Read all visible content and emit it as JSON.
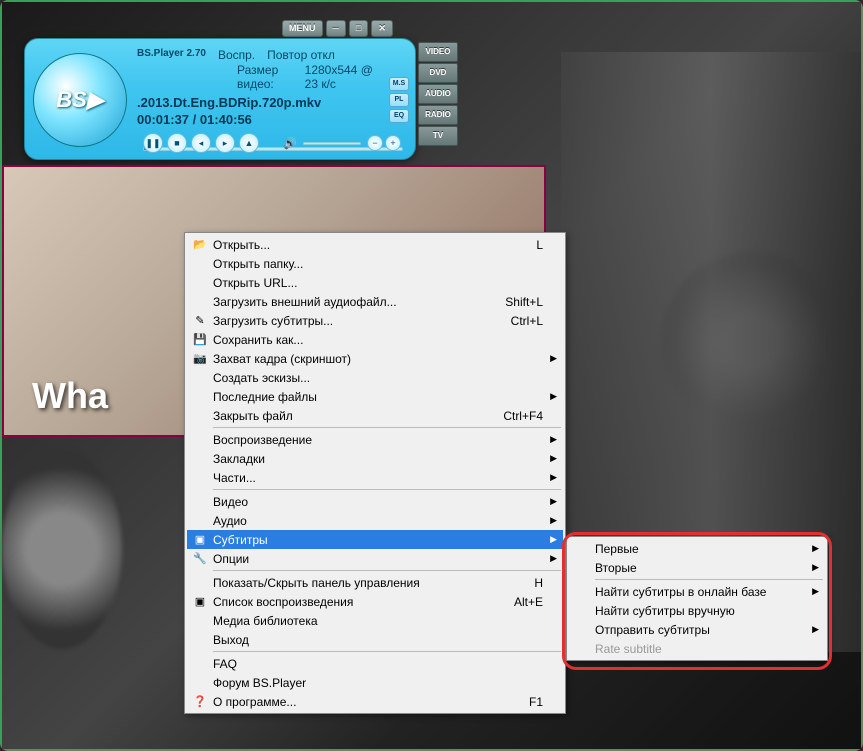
{
  "topbar": {
    "menu": "MENU"
  },
  "player": {
    "logo": "BS▶",
    "title": "BS.Player 2.70",
    "playback": "Воспр.",
    "repeat": "Повтор откл",
    "videosize_label": "Размер видео:",
    "videosize": "1280x544 @ 23 к/с",
    "file": ".2013.Dt.Eng.BDRip.720p.mkv",
    "time": "00:01:37 / 01:40:56",
    "lang_btns": [
      "M.S",
      "PL",
      "EQ"
    ]
  },
  "sidebar": [
    "VIDEO",
    "DVD",
    "AUDIO",
    "RADIO",
    "TV"
  ],
  "video": {
    "text": "Wha"
  },
  "menu": [
    {
      "icon": "📂",
      "label": "Открыть...",
      "hotkey": "L"
    },
    {
      "label": "Открыть папку..."
    },
    {
      "label": "Открыть URL..."
    },
    {
      "label": "Загрузить внешний аудиофайл...",
      "hotkey": "Shift+L"
    },
    {
      "icon": "✎",
      "label": "Загрузить субтитры...",
      "hotkey": "Ctrl+L"
    },
    {
      "icon": "💾",
      "label": "Сохранить как..."
    },
    {
      "icon": "📷",
      "label": "Захват кадра (скриншот)",
      "arrow": true
    },
    {
      "label": "Создать эскизы..."
    },
    {
      "label": "Последние файлы",
      "arrow": true
    },
    {
      "label": "Закрыть файл",
      "hotkey": "Ctrl+F4"
    },
    {
      "sep": true
    },
    {
      "label": "Воспроизведение",
      "arrow": true
    },
    {
      "label": "Закладки",
      "arrow": true
    },
    {
      "label": "Части...",
      "arrow": true
    },
    {
      "sep": true
    },
    {
      "label": "Видео",
      "arrow": true
    },
    {
      "label": "Аудио",
      "arrow": true
    },
    {
      "icon": "▣",
      "label": "Субтитры",
      "arrow": true,
      "sel": true
    },
    {
      "icon": "🔧",
      "label": "Опции",
      "arrow": true
    },
    {
      "sep": true
    },
    {
      "label": "Показать/Скрыть панель управления",
      "hotkey": "H"
    },
    {
      "icon": "▣",
      "label": "Список воспроизведения",
      "hotkey": "Alt+E"
    },
    {
      "label": "Медиа библиотека"
    },
    {
      "label": "Выход"
    },
    {
      "sep": true
    },
    {
      "label": "FAQ"
    },
    {
      "label": "Форум BS.Player"
    },
    {
      "icon": "❓",
      "label": "О программе...",
      "hotkey": "F1"
    }
  ],
  "submenu": [
    {
      "label": "Первые",
      "arrow": true
    },
    {
      "label": "Вторые",
      "arrow": true
    },
    {
      "sep": true
    },
    {
      "label": "Найти субтитры в онлайн базе",
      "arrow": true
    },
    {
      "label": "Найти субтитры вручную"
    },
    {
      "label": "Отправить субтитры",
      "arrow": true
    },
    {
      "label": "Rate subtitle",
      "disabled": true
    }
  ]
}
